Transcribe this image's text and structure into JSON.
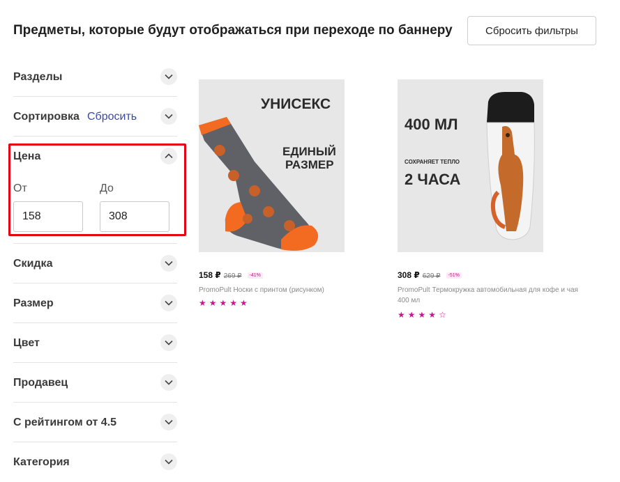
{
  "header": {
    "title": "Предметы, которые будут отображаться при переходе по баннеру",
    "reset_filters_label": "Сбросить фильтры"
  },
  "filters": {
    "sections": {
      "razdely": "Разделы",
      "sortirovka": "Сортировка",
      "sortirovka_reset": "Сбросить",
      "cena": "Цена",
      "skidka": "Скидка",
      "razmer": "Размер",
      "cvet": "Цвет",
      "prodavec": "Продавец",
      "reyting": "С рейтингом от 4.5",
      "kategoriya": "Категория"
    },
    "price": {
      "from_label": "От",
      "to_label": "До",
      "from_value": "158",
      "to_value": "308"
    }
  },
  "products": [
    {
      "image_lines": [
        "УНИСЕКС",
        "ЕДИНЫЙ",
        "РАЗМЕР"
      ],
      "price": "158 ₽",
      "old_price": "269 ₽",
      "discount": "-41%",
      "name": "PromoPult Носки с принтом (рисунком)",
      "rating": 5,
      "stars_text": "★★★★★"
    },
    {
      "image_lines": [
        "400 МЛ",
        "СОХРАНЯЕТ ТЕПЛО",
        "2 ЧАСА"
      ],
      "price": "308 ₽",
      "old_price": "629 ₽",
      "discount": "-51%",
      "name": "PromoPult Термокружка автомобильная для кофе и чая 400 мл",
      "rating": 4,
      "stars_text": "★★★★☆"
    }
  ],
  "colors": {
    "highlight_border": "#e30613",
    "accent_pink": "#c7168f",
    "link_blue": "#3b4aa0",
    "sock_orange": "#f36b21",
    "sock_grey": "#5f6166"
  },
  "icons": {
    "chevron_down": "chevron-down-icon",
    "chevron_up": "chevron-up-icon",
    "star": "star-icon"
  }
}
